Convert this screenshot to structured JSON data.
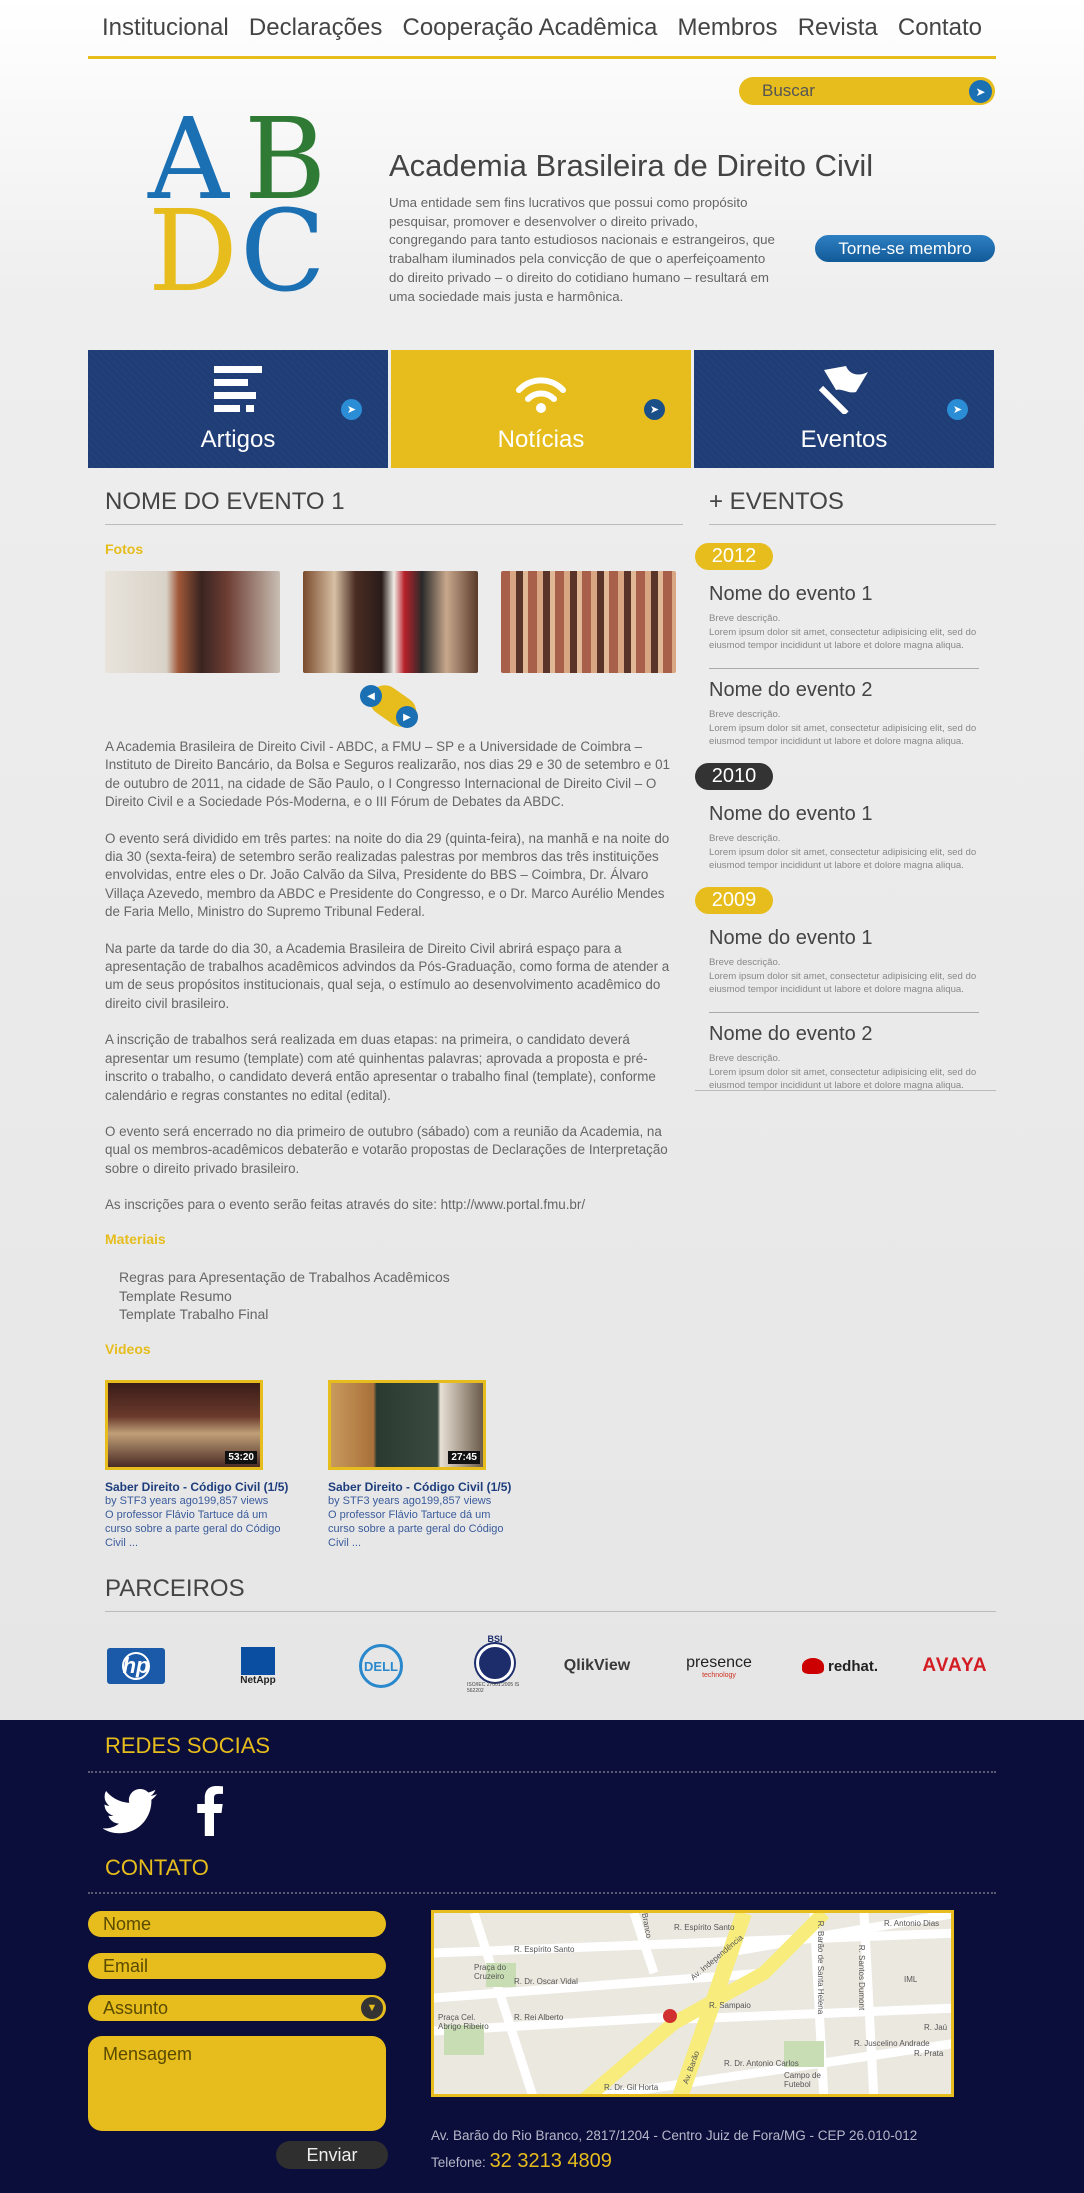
{
  "nav": [
    "Institucional",
    "Declarações",
    "Cooperação Acadêmica",
    "Membros",
    "Revista",
    "Contato"
  ],
  "search": {
    "label": "Buscar"
  },
  "logo": {
    "letters": [
      "A",
      "B",
      "D",
      "C"
    ],
    "colors": [
      "#1b6fb3",
      "#2f7a35",
      "#e6bd1c",
      "#1b6fb3"
    ]
  },
  "org": {
    "title": "Academia Brasileira de Direito Civil",
    "description": "Uma entidade sem fins lucrativos que possui como propósito pesquisar, promover e desenvolver o direito privado, congregando para tanto estudiosos nacionais e estrangeiros, que trabalham iluminados pela convicção de que o aperfeiçoamento do direito privado – o direito do cotidiano humano – resultará em uma sociedade mais justa e harmônica.",
    "member_button": "Torne-se membro"
  },
  "tiles": [
    {
      "label": "Artigos",
      "icon": "list-icon"
    },
    {
      "label": "Notícias",
      "icon": "rss-icon"
    },
    {
      "label": "Eventos",
      "icon": "flag-icon"
    }
  ],
  "event": {
    "title": "NOME DO EVENTO 1",
    "photos_label": "Fotos",
    "paragraphs": [
      "A Academia Brasileira de Direito Civil - ABDC, a FMU – SP e a Universidade de Coimbra – Instituto de Direito Bancário, da Bolsa e Seguros realizarão, nos dias 29 e 30 de setembro e 01 de outubro de 2011, na cidade de São Paulo, o I Congresso Internacional de Direito Civil – O Direito Civil e a Sociedade Pós-Moderna, e o III Fórum de Debates da ABDC.",
      "O evento será dividido em três partes: na noite do dia 29 (quinta-feira), na manhã e na noite do dia 30 (sexta-feira) de setembro serão realizadas palestras por membros das três instituições envolvidas, entre eles o Dr. João Calvão da Silva, Presidente do BBS – Coimbra, Dr. Álvaro Villaça Azevedo, membro da ABDC e Presidente do Congresso, e o Dr. Marco Aurélio Mendes de Faria Mello, Ministro do Supremo Tribunal Federal.",
      "Na parte da tarde do dia 30, a Academia Brasileira de Direito Civil abrirá espaço para a apresentação de trabalhos acadêmicos advindos da Pós-Graduação, como forma de atender a um de seus propósitos institucionais, qual seja, o estímulo ao desenvolvimento acadêmico do direito civil brasileiro.",
      "A inscrição de trabalhos será realizada em duas etapas: na primeira, o candidato deverá apresentar um resumo (template) com até quinhentas palavras; aprovada a proposta e pré-inscrito o trabalho, o candidato deverá então apresentar o trabalho final (template), conforme calendário e regras constantes no edital (edital).",
      "O evento será encerrado no dia primeiro de outubro (sábado) com a reunião da Academia, na qual os membros-acadêmicos debaterão e votarão propostas de Declarações de Interpretação sobre o direito privado brasileiro.",
      "As inscrições para o evento serão feitas através do site: http://www.portal.fmu.br/"
    ],
    "materials_label": "Materiais",
    "materials": [
      "Regras para Apresentação de Trabalhos Acadêmicos",
      "Template Resumo",
      "Template Trabalho Final"
    ],
    "videos_label": "Videos",
    "videos": [
      {
        "title": "Saber Direito - Código Civil (1/5)",
        "meta": "by STF3 years ago199,857 views",
        "desc": "O professor Flávio Tartuce dá um curso sobre a parte geral do Código Civil ...",
        "duration": "53:20"
      },
      {
        "title": "Saber Direito - Código Civil (1/5)",
        "meta": "by STF3 years ago199,857 views",
        "desc": "O professor Flávio Tartuce dá um curso sobre a parte geral do Código Civil ...",
        "duration": "27:45"
      }
    ]
  },
  "sidebar": {
    "title": "+ EVENTOS",
    "years": [
      "2012",
      "2010",
      "2009"
    ],
    "events": [
      {
        "name": "Nome do evento 1",
        "label": "Breve descrição.",
        "text": "Lorem ipsum dolor sit amet, consectetur adipisicing elit, sed do eiusmod tempor incididunt ut labore et dolore magna aliqua."
      },
      {
        "name": "Nome do evento 2",
        "label": "Breve descrição.",
        "text": "Lorem ipsum dolor sit amet, consectetur adipisicing elit, sed do eiusmod tempor incididunt ut labore et dolore magna aliqua."
      },
      {
        "name": "Nome do evento 1",
        "label": "Breve descrição.",
        "text": "Lorem ipsum dolor sit amet, consectetur adipisicing elit, sed do eiusmod tempor incididunt ut labore et dolore magna aliqua."
      },
      {
        "name": "Nome do evento 1",
        "label": "Breve descrição.",
        "text": "Lorem ipsum dolor sit amet, consectetur adipisicing elit, sed do eiusmod tempor incididunt ut labore et dolore magna aliqua."
      },
      {
        "name": "Nome do evento 2",
        "label": "Breve descrição.",
        "text": "Lorem ipsum dolor sit amet, consectetur adipisicing elit, sed do eiusmod tempor incididunt ut labore et dolore magna aliqua."
      }
    ]
  },
  "partners": {
    "title": "PARCEIROS",
    "logos": [
      "hp",
      "NetApp",
      "DELL",
      "BSI",
      "QlikView",
      "presence",
      "redhat.",
      "AVAYA"
    ],
    "logo_subtexts": {
      "bsi": "ISO/IEC 27001:2005 IS 562202",
      "presence": "technology"
    }
  },
  "footer": {
    "social_title": "REDES SOCIAS",
    "contact_title": "CONTATO",
    "fields": {
      "name": "Nome",
      "email": "Email",
      "subject": "Assunto",
      "message": "Mensagem"
    },
    "send": "Enviar",
    "address": "Av. Barão do Rio Branco, 2817/1204 - Centro Juiz de Fora/MG - CEP 26.010-012",
    "phone_label": "Telefone:",
    "phone": "32 3213 4809",
    "map_labels": [
      "R. Espírito Santo",
      "Av. Independência",
      "R. Dr. Oscar Vidal",
      "R. Rei Alberto",
      "R. Sampaio",
      "R. Dr. Antonio Carlos",
      "R. Barão de Santa Helena",
      "R. Santos Dumont",
      "R. Antonio Dias",
      "Praça do Cruzeiro",
      "Praça Cel. Abrigo Ribeiro",
      "Campo de Futebol",
      "Av. Barão",
      "R. Dr. Gil Horta",
      "R. Juscelino Andrade",
      "IML",
      "R. Prata",
      "R. Jaú",
      "R. Espírito Santo",
      "Branco"
    ]
  },
  "colors": {
    "accent": "#e6bd1c",
    "navy": "#1f3c74",
    "footer": "#0b0d3b",
    "blue": "#1b6fb3"
  }
}
